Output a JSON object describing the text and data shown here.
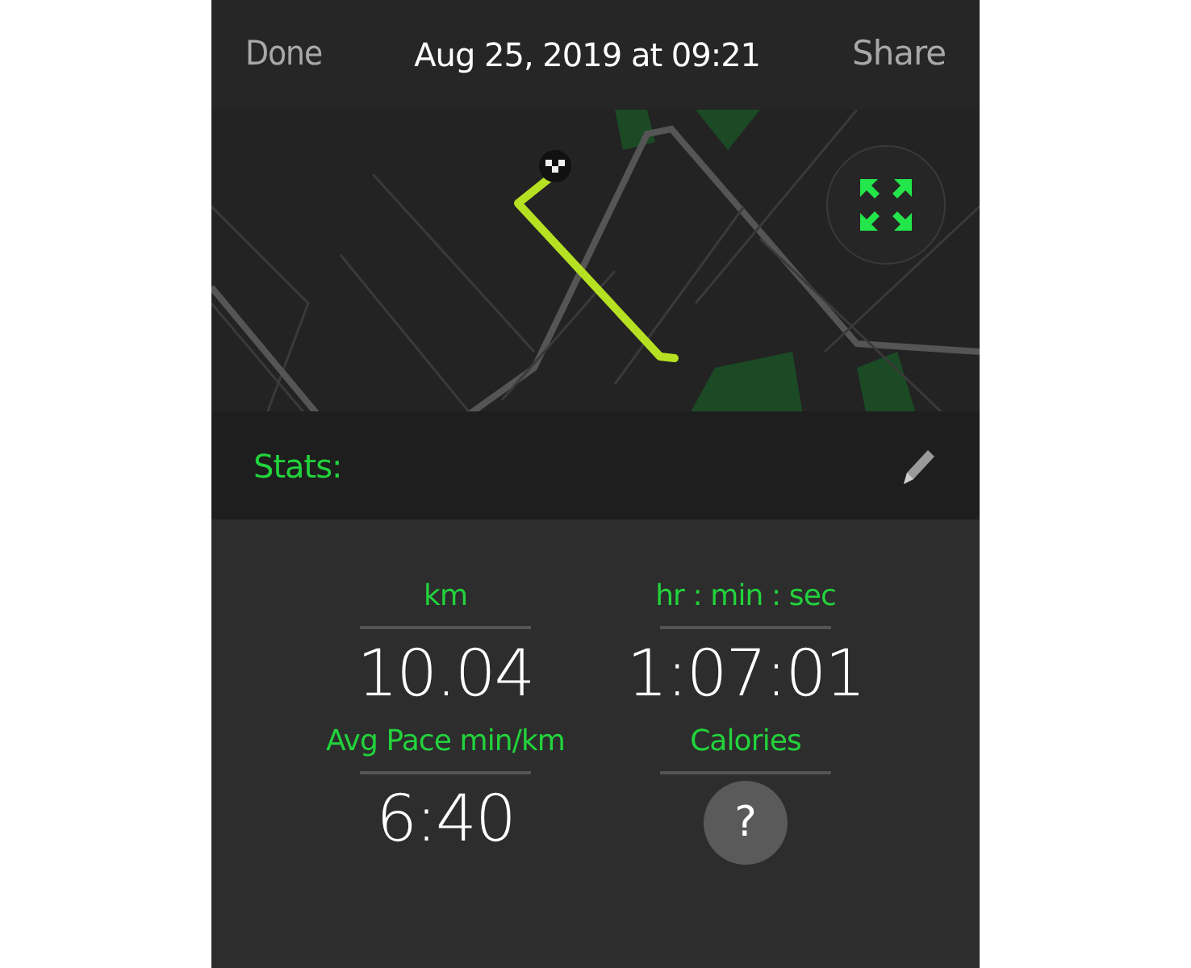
{
  "header": {
    "left_button": "Done",
    "title": "Aug 25, 2019 at 09:21",
    "right_button": "Share"
  },
  "stats_bar": {
    "label": "Stats:"
  },
  "stats": [
    {
      "kind": "value",
      "label": "km",
      "value": "10.04"
    },
    {
      "kind": "value",
      "label": "hr : min : sec",
      "value": "1:07:01"
    },
    {
      "kind": "value",
      "label": "Avg Pace min/km",
      "value": "6:40"
    },
    {
      "kind": "unknown",
      "label": "Calories",
      "value": "?"
    }
  ]
}
